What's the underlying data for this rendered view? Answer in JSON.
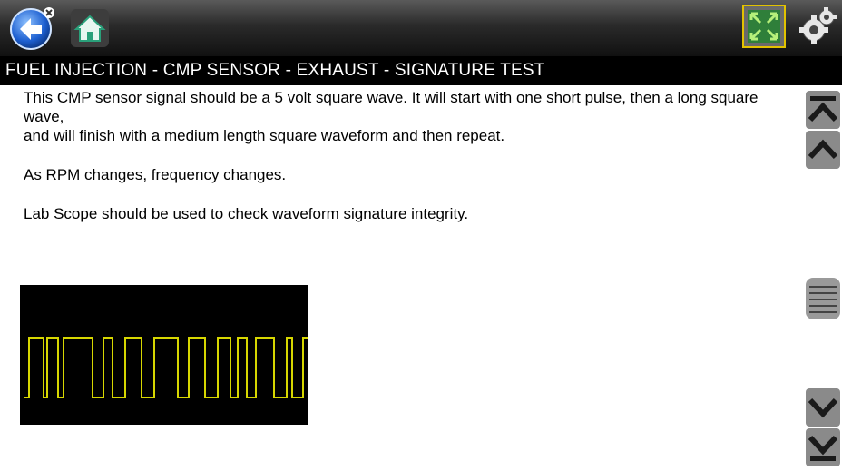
{
  "toolbar": {
    "back_icon": "back-arrow-icon",
    "home_icon": "home-icon",
    "fit_icon": "expand-fit-icon",
    "settings_icon": "gear-icon",
    "fit_border_color": "#e2c200"
  },
  "title": "FUEL INJECTION - CMP SENSOR - EXHAUST - SIGNATURE TEST",
  "body": {
    "line1": "This CMP sensor signal should be a 5 volt square wave. It will start with one short pulse, then a long square wave,",
    "line2": "and will finish with a medium length square waveform and then repeat.",
    "line3": "As RPM changes, frequency changes.",
    "line4": "Lab Scope should be used to check waveform signature integrity."
  },
  "scope": {
    "background": "#000000",
    "trace_color": "#d6d600"
  },
  "scrollbar": {
    "top_icon": "scroll-to-top-icon",
    "up_icon": "scroll-up-icon",
    "thumb_icon": "scroll-thumb-icon",
    "down_icon": "scroll-down-icon",
    "bottom_icon": "scroll-to-bottom-icon"
  }
}
